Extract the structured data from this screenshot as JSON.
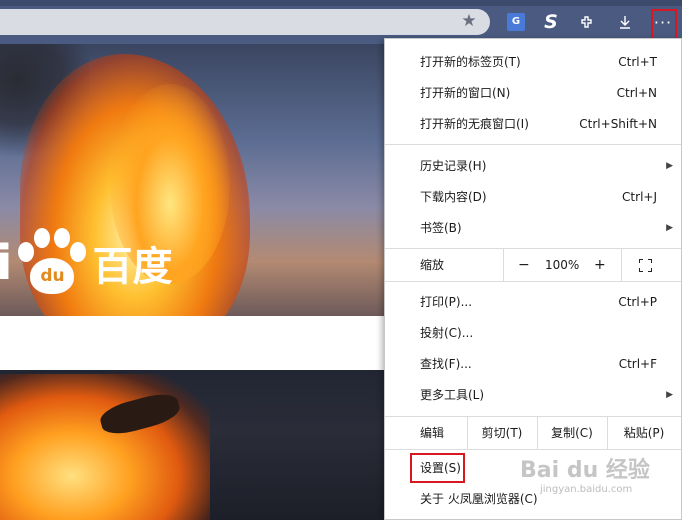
{
  "toolbar": {
    "translate_icon": "translate-icon",
    "star_icon": "favorite-star-icon",
    "s_icon_letter": "S",
    "translate_letter": "G",
    "ext_icon": "extensions-icon",
    "download_icon": "download-icon",
    "more_icon": "more-menu-icon",
    "more_glyph": "···"
  },
  "background": {
    "logo_latin": "i",
    "logo_paw_text": "du",
    "logo_chinese": "百度"
  },
  "menu": {
    "new_tab": {
      "label": "打开新的标签页(T)",
      "shortcut": "Ctrl+T"
    },
    "new_window": {
      "label": "打开新的窗口(N)",
      "shortcut": "Ctrl+N"
    },
    "new_private": {
      "label": "打开新的无痕窗口(I)",
      "shortcut": "Ctrl+Shift+N"
    },
    "history": {
      "label": "历史记录(H)"
    },
    "downloads": {
      "label": "下载内容(D)",
      "shortcut": "Ctrl+J"
    },
    "bookmarks": {
      "label": "书签(B)"
    },
    "zoom": {
      "label": "缩放",
      "minus": "−",
      "value": "100%",
      "plus": "+"
    },
    "print": {
      "label": "打印(P)...",
      "shortcut": "Ctrl+P"
    },
    "cast": {
      "label": "投射(C)..."
    },
    "find": {
      "label": "查找(F)...",
      "shortcut": "Ctrl+F"
    },
    "more_tools": {
      "label": "更多工具(L)"
    },
    "edit": {
      "label": "编辑",
      "cut": "剪切(T)",
      "copy": "复制(C)",
      "paste": "粘贴(P)"
    },
    "settings": {
      "label": "设置(S)"
    },
    "about": {
      "label": "关于 火凤凰浏览器(C)"
    }
  },
  "watermark": {
    "text": "Bai du 经验",
    "sub": "jingyan.baidu.com"
  },
  "colors": {
    "highlight": "#d81820",
    "toolbar": "#4a5a80"
  }
}
